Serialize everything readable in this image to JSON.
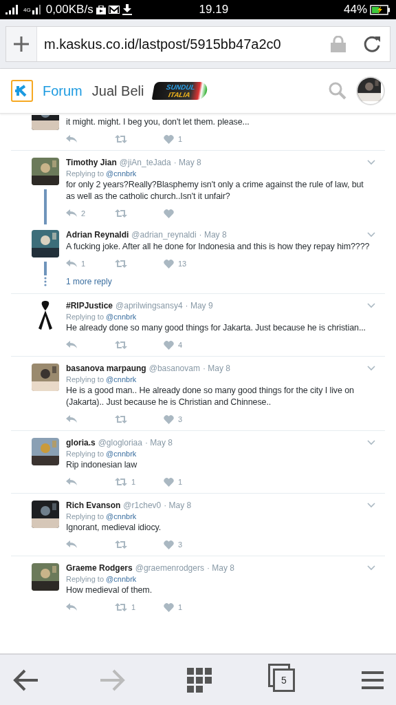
{
  "status_bar": {
    "network": "4G",
    "speed": "0,00KB/s",
    "time": "19.19",
    "battery": "44%",
    "charging": true
  },
  "address_bar": {
    "url": "m.kaskus.co.id/lastpost/5915bb47a2c0",
    "secure": true
  },
  "site_header": {
    "tabs": [
      {
        "label": "Forum",
        "selected": true
      },
      {
        "label": "Jual Beli",
        "selected": false
      }
    ],
    "banner": [
      "SUNDUL",
      "ITALIA"
    ]
  },
  "tweets": [
    {
      "kind": "partial",
      "text": "it might. might. I beg you, don't let them. please...",
      "likes": "1"
    },
    {
      "kind": "thread",
      "name": "Timothy Jian",
      "handle": "@jiAn_teJada",
      "date": "· May 8",
      "replying_label": "Replying to",
      "replying_to": "@cnnbrk",
      "text": "for only 2 years?Really?Blasphemy isn't only a crime against the rule of law, but as well as the catholic church..Isn't it unfair?",
      "replies": "2",
      "children": [
        {
          "name": "Adrian Reynaldi",
          "handle": "@adrian_reynaldi",
          "date": "· May 8",
          "text": "A fucking joke. After all he done for Indonesia and this is how they repay him????",
          "replies": "1",
          "likes": "13"
        }
      ],
      "more_replies": "1 more reply"
    },
    {
      "kind": "ribbon",
      "name": "#RIPJustice",
      "handle": "@aprilwingsansy4",
      "date": "· May 9",
      "replying_label": "Replying to",
      "replying_to": "@cnnbrk",
      "text": "He already done so many good things for Jakarta. Just because he is christian...",
      "likes": "4"
    },
    {
      "kind": "single",
      "name": "basanova marpaung",
      "handle": "@basanovam",
      "date": "· May 8",
      "replying_label": "Replying to",
      "replying_to": "@cnnbrk",
      "text": "He is a good man.. He already done so many good things for the city I live on (Jakarta).. Just because he is Christian and Chinnese..",
      "likes": "3"
    },
    {
      "kind": "single",
      "name": "gloria.s",
      "handle": "@glogloriaa",
      "date": "· May 8",
      "replying_label": "Replying to",
      "replying_to": "@cnnbrk",
      "text": "Rip indonesian law",
      "retweets": "1",
      "likes": "1"
    },
    {
      "kind": "single",
      "name": "Rich Evanson",
      "handle": "@r1chev0",
      "date": "· May 8",
      "replying_label": "Replying to",
      "replying_to": "@cnnbrk",
      "text": "Ignorant, medieval idiocy.",
      "likes": "3"
    },
    {
      "kind": "single",
      "name": "Graeme Rodgers",
      "handle": "@graemenrodgers",
      "date": "· May 8",
      "replying_label": "Replying to",
      "replying_to": "@cnnbrk",
      "text": "How medieval of them.",
      "retweets": "1",
      "likes": "1"
    }
  ],
  "bottom_bar": {
    "back_disabled": false,
    "forward_disabled": true,
    "tab_count": "5"
  }
}
